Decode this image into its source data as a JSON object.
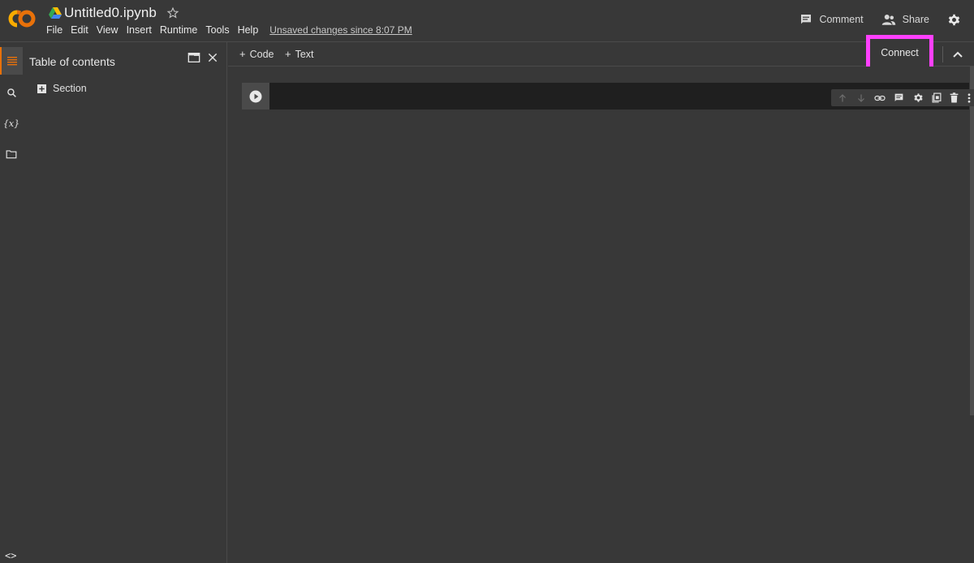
{
  "header": {
    "title": "Untitled0.ipynb",
    "menu": [
      "File",
      "Edit",
      "View",
      "Insert",
      "Runtime",
      "Tools",
      "Help"
    ],
    "unsaved": "Unsaved changes since 8:07 PM",
    "comment_label": "Comment",
    "share_label": "Share"
  },
  "sidebar": {
    "icons": [
      "toc-icon",
      "search-icon",
      "variables-icon",
      "folder-icon",
      "code-snippets-icon"
    ],
    "variables_glyph": "{x}",
    "code_glyph": "<>"
  },
  "toc": {
    "title": "Table of contents",
    "section_label": "Section"
  },
  "toolbar": {
    "code_label": "Code",
    "text_label": "Text",
    "connect_label": "Connect"
  },
  "colors": {
    "accent": "#e8710a",
    "highlight": "#ff40ff",
    "background": "#383838",
    "cell_bg": "#1f1f1f"
  }
}
